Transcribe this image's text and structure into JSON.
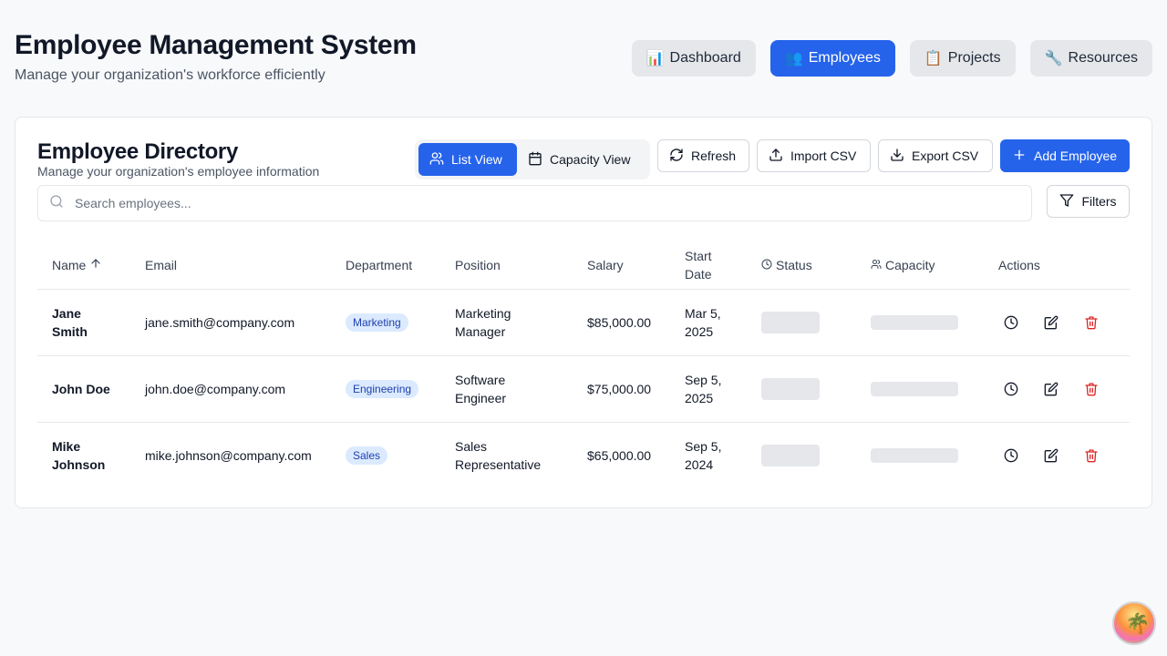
{
  "app": {
    "title": "Employee Management System",
    "subtitle": "Manage your organization's workforce efficiently"
  },
  "nav": [
    {
      "emoji": "📊",
      "label": "Dashboard",
      "active": false
    },
    {
      "emoji": "👥",
      "label": "Employees",
      "active": true
    },
    {
      "emoji": "📋",
      "label": "Projects",
      "active": false
    },
    {
      "emoji": "🔧",
      "label": "Resources",
      "active": false
    }
  ],
  "directory": {
    "title": "Employee Directory",
    "subtitle": "Manage your organization's employee information",
    "view_toggle": {
      "list": "List View",
      "capacity": "Capacity View",
      "active": "list"
    },
    "buttons": {
      "refresh": "Refresh",
      "import": "Import CSV",
      "export": "Export CSV",
      "add": "Add Employee"
    },
    "search": {
      "placeholder": "Search employees...",
      "value": ""
    },
    "filters_label": "Filters"
  },
  "table": {
    "headers": {
      "name": "Name",
      "email": "Email",
      "department": "Department",
      "position": "Position",
      "salary": "Salary",
      "start_date": "Start Date",
      "status": "Status",
      "capacity": "Capacity",
      "actions": "Actions"
    },
    "sort": {
      "column": "name",
      "direction": "asc"
    },
    "rows": [
      {
        "name": "Jane Smith",
        "email": "jane.smith@company.com",
        "department": "Marketing",
        "position": "Marketing Manager",
        "salary": "$85,000.00",
        "start_date": "Mar 5, 2025"
      },
      {
        "name": "John Doe",
        "email": "john.doe@company.com",
        "department": "Engineering",
        "position": "Software Engineer",
        "salary": "$75,000.00",
        "start_date": "Sep 5, 2025"
      },
      {
        "name": "Mike Johnson",
        "email": "mike.johnson@company.com",
        "department": "Sales",
        "position": "Sales Representative",
        "salary": "$65,000.00",
        "start_date": "Sep 5, 2024"
      }
    ]
  },
  "colors": {
    "primary": "#2563eb",
    "danger": "#dc2626",
    "badge_bg": "#dbeafe",
    "badge_text": "#1e40af"
  }
}
